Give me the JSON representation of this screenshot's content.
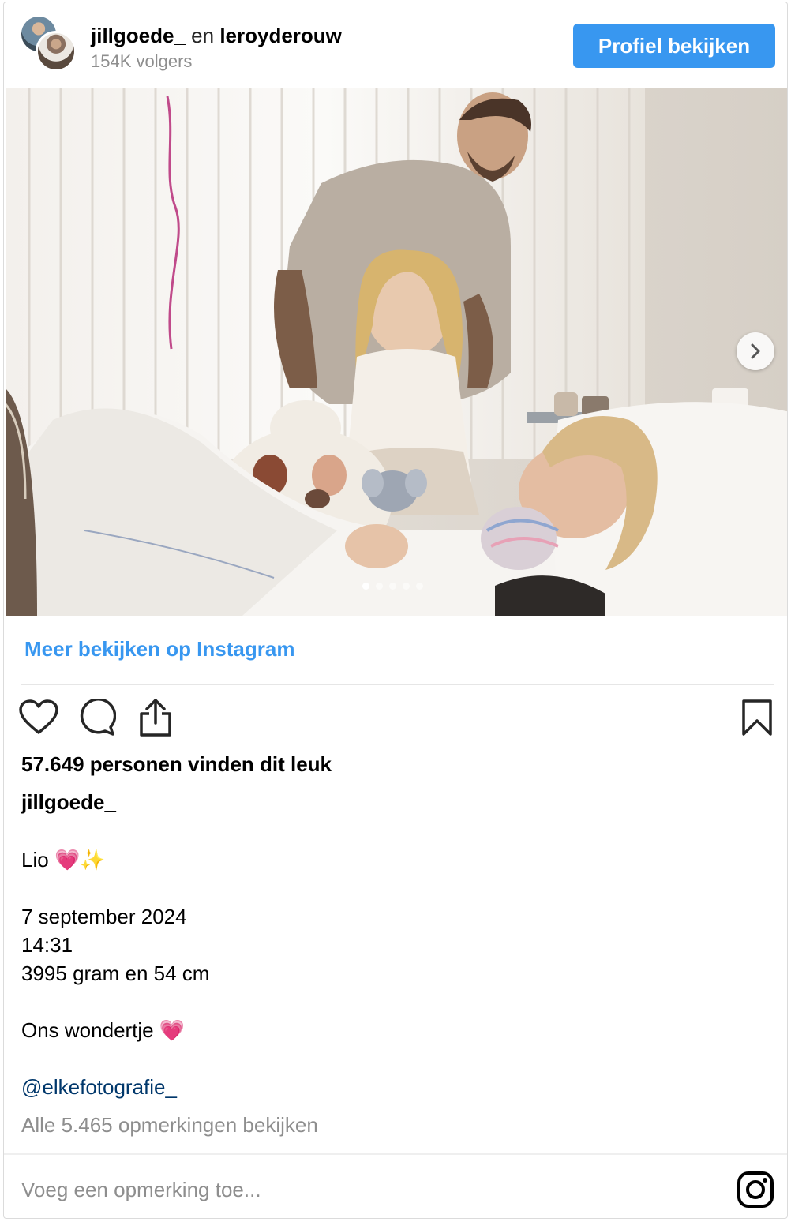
{
  "header": {
    "user1": "jillgoede_",
    "conjunction": "en",
    "user2": "leroyderouw",
    "followers": "154K volgers",
    "profile_button": "Profiel bekijken"
  },
  "carousel": {
    "total_slides": 5,
    "active_slide": 1
  },
  "more_link": "Meer bekijken op Instagram",
  "actions": {
    "like_icon": "heart-icon",
    "comment_icon": "comment-icon",
    "share_icon": "share-icon",
    "save_icon": "bookmark-icon"
  },
  "likes": "57.649 personen vinden dit leuk",
  "author": "jillgoede_",
  "caption": {
    "line1": "Lio",
    "line1_emoji_heart": "💗",
    "line1_emoji_sparkle": "✨",
    "date": "7 september 2024",
    "time": "14:31",
    "weight": "3995 gram en 54 cm",
    "closing": "Ons wondertje",
    "closing_emoji": "💗"
  },
  "mention": "@elkefotografie_",
  "all_comments": "Alle 5.465 opmerkingen bekijken",
  "comment_placeholder": "Voeg een opmerking toe...",
  "colors": {
    "accent": "#3897f0",
    "muted": "#8e8e8e",
    "mention": "#00376b",
    "heart_emoji": "#e6399b"
  }
}
